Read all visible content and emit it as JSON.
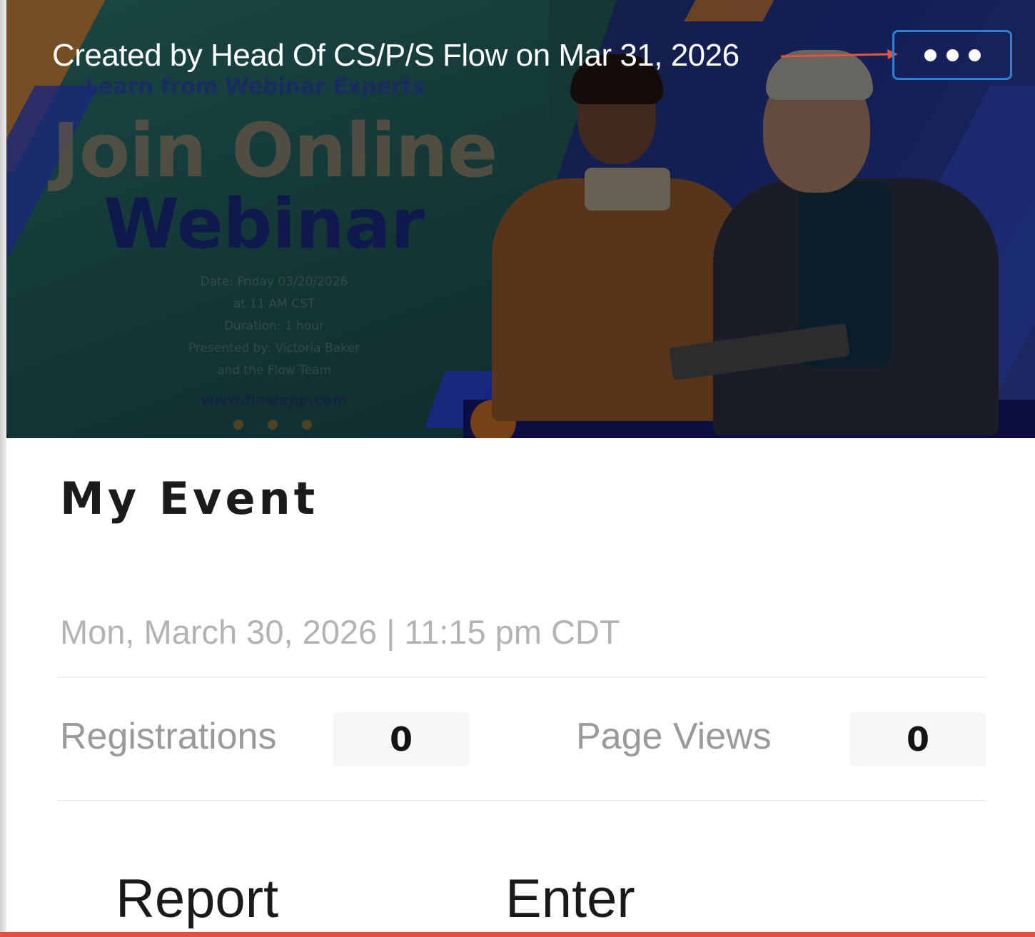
{
  "card": {
    "created_by_text": "Created by Head Of CS/P/S Flow on Mar 31, 2026",
    "image": {
      "kicker": "Learn from Webinar Experts",
      "title_line_1": "Join Online",
      "title_line_2": "Webinar",
      "details": [
        "Date: Friday 03/20/2026",
        "at 11 AM CST",
        "Duration: 1 hour",
        "Presented by: Victoria Baker",
        "and the Flow Team"
      ],
      "url": "www.flowapp.com"
    },
    "more_menu_icon": "ellipsis-icon",
    "title": "My Event",
    "datetime": "Mon, March 30, 2026 | 11:15 pm CDT",
    "stats": {
      "registrations_label": "Registrations",
      "registrations_value": "0",
      "page_views_label": "Page Views",
      "page_views_value": "0"
    },
    "actions": {
      "report_label": "Report",
      "enter_label": "Enter"
    }
  },
  "annotation": {
    "highlight_color": "#2f7fd3",
    "arrow_color": "#e5533c"
  },
  "colors": {
    "bottom_accent": "#e84c3d",
    "title_text": "#1b1b1b",
    "muted_text": "#9a9a9a"
  }
}
